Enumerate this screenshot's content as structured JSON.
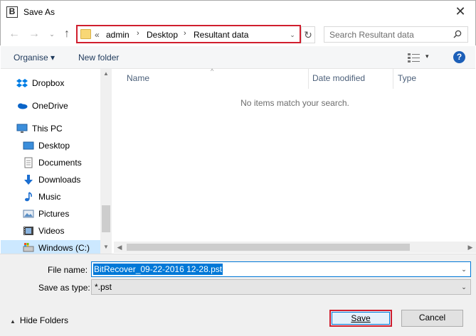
{
  "window": {
    "title": "Save As",
    "close_glyph": "✕"
  },
  "nav": {
    "back_glyph": "←",
    "forward_glyph": "→",
    "recent_glyph": "⌄",
    "up_glyph": "↑",
    "breadcrumb_prefix": "«",
    "breadcrumbs": [
      "admin",
      "Desktop",
      "Resultant data"
    ],
    "breadcrumb_sep": "›",
    "address_dropdown_glyph": "⌄",
    "refresh_glyph": "↻"
  },
  "search": {
    "placeholder": "Search Resultant data"
  },
  "toolbar": {
    "organise_label": "Organise ▾",
    "new_folder_label": "New folder",
    "view_dropdown_glyph": "▾",
    "help_glyph": "?"
  },
  "sidebar": {
    "items": [
      {
        "label": "Dropbox",
        "icon": "dropbox-icon"
      },
      {
        "label": "OneDrive",
        "icon": "onedrive-icon"
      },
      {
        "label": "This PC",
        "icon": "pc-icon"
      },
      {
        "label": "Desktop",
        "icon": "desktop-icon"
      },
      {
        "label": "Documents",
        "icon": "documents-icon"
      },
      {
        "label": "Downloads",
        "icon": "downloads-icon"
      },
      {
        "label": "Music",
        "icon": "music-icon"
      },
      {
        "label": "Pictures",
        "icon": "pictures-icon"
      },
      {
        "label": "Videos",
        "icon": "videos-icon"
      },
      {
        "label": "Windows (C:)",
        "icon": "drive-icon"
      }
    ]
  },
  "file_list": {
    "columns": [
      "Name",
      "Date modified",
      "Type"
    ],
    "sort_glyph": "^",
    "empty_message": "No items match your search."
  },
  "scrollbars": {
    "up_glyph": "▲",
    "down_glyph": "▼",
    "left_glyph": "◀",
    "right_glyph": "▶"
  },
  "form": {
    "file_name_label": "File name:",
    "file_name_value": "BitRecover_09-22-2016 12-28.pst",
    "save_as_type_label": "Save as type:",
    "save_as_type_value": "*.pst",
    "dropdown_glyph": "⌄"
  },
  "footer": {
    "hide_folders_label": "Hide Folders",
    "hide_folders_glyph": "▲",
    "save_label": "Save",
    "cancel_label": "Cancel"
  },
  "colors": {
    "highlight_red": "#d01e2e",
    "accent_blue": "#0078d7"
  }
}
